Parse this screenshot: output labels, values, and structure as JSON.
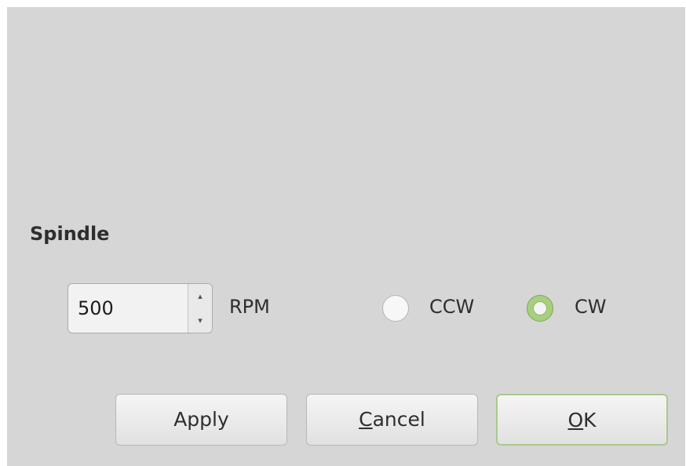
{
  "section": {
    "title": "Spindle"
  },
  "speed": {
    "value": "500",
    "unit": "RPM",
    "up_arrow": "▴",
    "down_arrow": "▾"
  },
  "direction": {
    "options": [
      {
        "label": "CCW",
        "selected": false
      },
      {
        "label": "CW",
        "selected": true
      }
    ],
    "accent_color": "#a8cf7e"
  },
  "buttons": {
    "apply": "Apply",
    "cancel_mnemonic": "C",
    "cancel_rest": "ancel",
    "ok_mnemonic": "O",
    "ok_rest": "K"
  }
}
